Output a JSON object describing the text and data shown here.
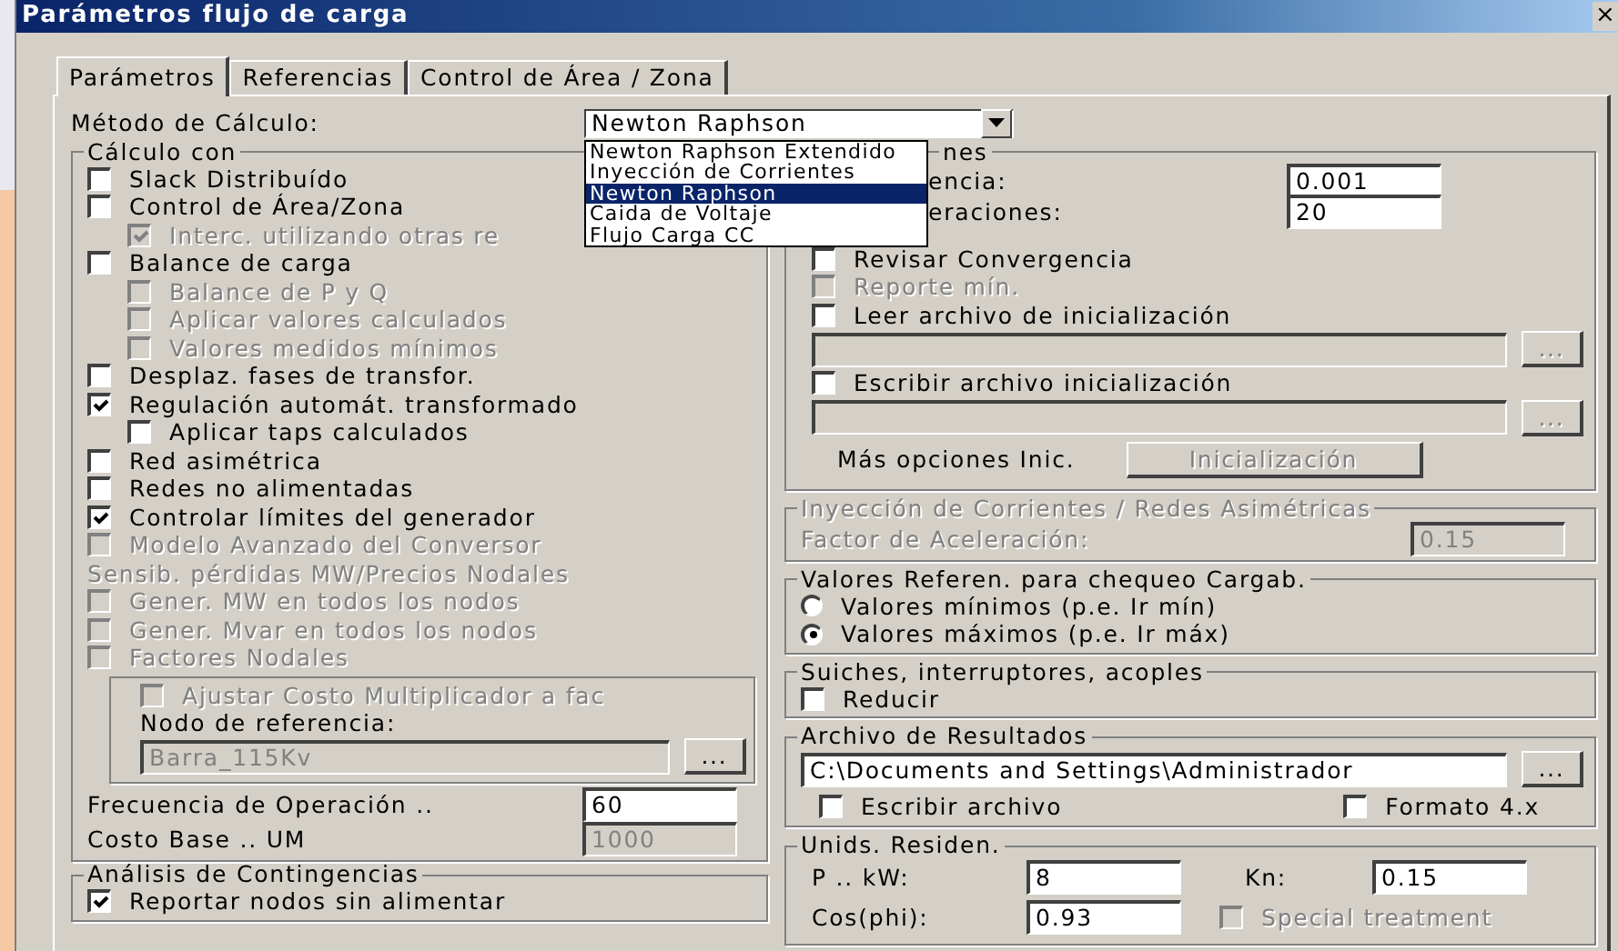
{
  "window": {
    "title": "Parámetros flujo de carga",
    "close": "×"
  },
  "tabs": [
    {
      "label": "Parámetros",
      "selected": true
    },
    {
      "label": "Referencias",
      "selected": false
    },
    {
      "label": "Control de Área / Zona",
      "selected": false
    }
  ],
  "method": {
    "label": "Método de Cálculo:",
    "value": "Newton Raphson",
    "options": [
      {
        "label": "Newton Raphson Extendido",
        "selected": false
      },
      {
        "label": "Inyección de Corrientes",
        "selected": false
      },
      {
        "label": "Newton Raphson",
        "selected": true
      },
      {
        "label": "Caida de Voltaje",
        "selected": false
      },
      {
        "label": "Flujo Carga CC",
        "selected": false
      }
    ]
  },
  "calculo": {
    "title": "Cálculo con",
    "items": [
      {
        "kind": "checkbox",
        "label": "Slack Distribuído",
        "checked": false,
        "disabled": false
      },
      {
        "kind": "checkbox",
        "label": "Control de Área/Zona",
        "checked": false,
        "disabled": false,
        "children": [
          {
            "kind": "checkbox",
            "label": "Interc. utilizando otras re",
            "checked": true,
            "disabled": true
          }
        ]
      },
      {
        "kind": "checkbox",
        "label": "Balance de carga",
        "checked": false,
        "disabled": false,
        "children": [
          {
            "kind": "checkbox",
            "label": "Balance de P y Q",
            "checked": false,
            "disabled": true
          },
          {
            "kind": "checkbox",
            "label": "Aplicar valores calculados",
            "checked": false,
            "disabled": true
          },
          {
            "kind": "checkbox",
            "label": "Valores medidos mínimos",
            "checked": false,
            "disabled": true
          }
        ]
      },
      {
        "kind": "checkbox",
        "label": "Desplaz. fases de transfor.",
        "checked": false,
        "disabled": false
      },
      {
        "kind": "checkbox",
        "label": "Regulación automát. transformado",
        "checked": true,
        "disabled": false,
        "children": [
          {
            "kind": "checkbox",
            "label": "Aplicar taps calculados",
            "checked": false,
            "disabled": false
          }
        ]
      },
      {
        "kind": "checkbox",
        "label": "Red asimétrica",
        "checked": false,
        "disabled": false
      },
      {
        "kind": "checkbox",
        "label": "Redes no alimentadas",
        "checked": false,
        "disabled": false
      },
      {
        "kind": "checkbox",
        "label": "Controlar límites del generador",
        "checked": true,
        "disabled": false
      },
      {
        "kind": "checkbox",
        "label": "Modelo Avanzado del Conversor",
        "checked": false,
        "disabled": true
      },
      {
        "kind": "label",
        "label": "Sensib. pérdidas MW/Precios Nodales",
        "disabled": true
      },
      {
        "kind": "checkbox",
        "label": "Gener. MW en todos los nodos",
        "checked": false,
        "disabled": true
      },
      {
        "kind": "checkbox",
        "label": "Gener. Mvar en todos los nodos",
        "checked": false,
        "disabled": true
      },
      {
        "kind": "checkbox",
        "label": "Factores Nodales",
        "checked": false,
        "disabled": true
      }
    ],
    "subgroup": {
      "checkbox": {
        "label": "Ajustar Costo Multiplicador a fac",
        "checked": false,
        "disabled": true
      },
      "ref_label": "Nodo de referencia:",
      "ref_value": "Barra_115Kv",
      "ref_button": "...",
      "disabled": true
    },
    "fields": [
      {
        "label": "Frecuencia de Operación ..",
        "value": "60",
        "disabled": false
      },
      {
        "label": "Costo Base .. UM",
        "value": "1000",
        "disabled": true
      }
    ]
  },
  "contingencias": {
    "title": "Análisis de Contingencias",
    "checkbox": {
      "label": "Reportar nodos sin alimentar",
      "checked": true,
      "disabled": false
    }
  },
  "iter": {
    "title": "nes",
    "fields": [
      {
        "label": "encia:",
        "value": "0.001"
      },
      {
        "label": "eraciones:",
        "value": "20"
      }
    ],
    "checks": [
      {
        "label": "Revisar Convergencia",
        "checked": false,
        "disabled": false
      },
      {
        "label": "Reporte mín.",
        "checked": false,
        "disabled": true
      },
      {
        "label": "Leer archivo de inicialización",
        "checked": false,
        "disabled": false,
        "path_button": "..."
      },
      {
        "label": "Escribir archivo inicialización",
        "checked": false,
        "disabled": false,
        "path_button": "..."
      }
    ],
    "more_label": "Más opciones Inic.",
    "more_button": "Inicialización"
  },
  "inyeccion": {
    "title": "Inyección de Corrientes / Redes Asimétricas",
    "label": "Factor de Aceleración:",
    "value": "0.15",
    "disabled": true
  },
  "valores": {
    "title": "Valores Referen. para chequeo Cargab.",
    "options": [
      {
        "label": "Valores mínimos (p.e. Ir mín)",
        "selected": false
      },
      {
        "label": "Valores máximos (p.e. Ir máx)",
        "selected": true
      }
    ]
  },
  "suiches": {
    "title": "Suiches, interruptores, acoples",
    "checkbox": {
      "label": "Reducir",
      "checked": false,
      "disabled": false
    }
  },
  "resultados": {
    "title": "Archivo de Resultados",
    "path": "C:\\Documents and Settings\\Administrador",
    "button": "...",
    "checks": [
      {
        "label": "Escribir archivo",
        "checked": false,
        "disabled": false
      },
      {
        "label": "Formato 4.x",
        "checked": false,
        "disabled": false
      }
    ]
  },
  "unids": {
    "title": "Unids. Residen.",
    "p_label": "P .. kW:",
    "p_value": "8",
    "kn_label": "Kn:",
    "kn_value": "0.15",
    "cos_label": "Cos(phi):",
    "cos_value": "0.93",
    "special": {
      "label": "Special treatment",
      "checked": false,
      "disabled": true
    }
  }
}
